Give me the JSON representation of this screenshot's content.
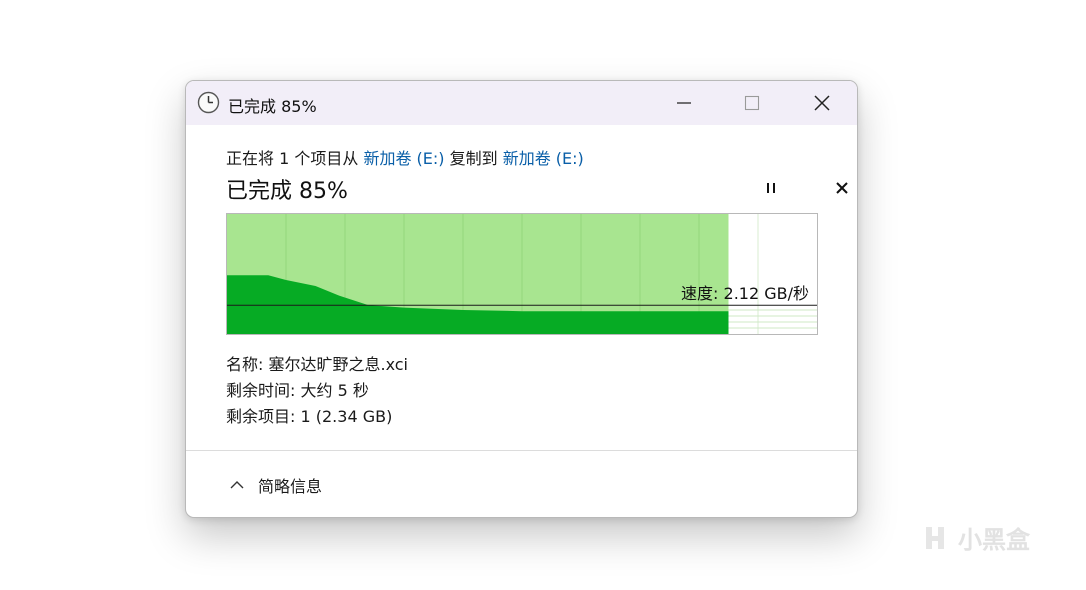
{
  "window": {
    "title": "已完成 85%",
    "icon": "clock-icon"
  },
  "copy": {
    "prefix": "正在将 1 个项目从 ",
    "source": "新加卷 (E:)",
    "middle": " 复制到 ",
    "destination": "新加卷 (E:)"
  },
  "progress": {
    "percent_text": "已完成 85%",
    "fraction": 0.85,
    "speed_label": "速度: 2.12 GB/秒"
  },
  "chart_data": {
    "type": "area",
    "title": "",
    "xlabel": "",
    "ylabel": "",
    "x": [
      0,
      0.025,
      0.07,
      0.1,
      0.15,
      0.19,
      0.24,
      0.3,
      0.4,
      0.5,
      0.6,
      0.7,
      0.8,
      0.85
    ],
    "y": [
      0.49,
      0.49,
      0.49,
      0.45,
      0.4,
      0.32,
      0.24,
      0.22,
      0.2,
      0.19,
      0.19,
      0.19,
      0.19,
      0.19
    ],
    "current_speed_level": 0.24,
    "xlim": [
      0,
      1
    ],
    "ylim": [
      0,
      1
    ],
    "grid": true
  },
  "details": {
    "name_label": "名称: ",
    "name_value": "塞尔达旷野之息.xci",
    "time_label": "剩余时间: ",
    "time_value": "大约 5 秒",
    "items_label": "剩余项目: ",
    "items_value": "1 (2.34 GB)"
  },
  "footer": {
    "toggle_label": "简略信息",
    "toggle_icon": "chevron-up-icon"
  },
  "watermark": {
    "text": "小黑盒"
  }
}
